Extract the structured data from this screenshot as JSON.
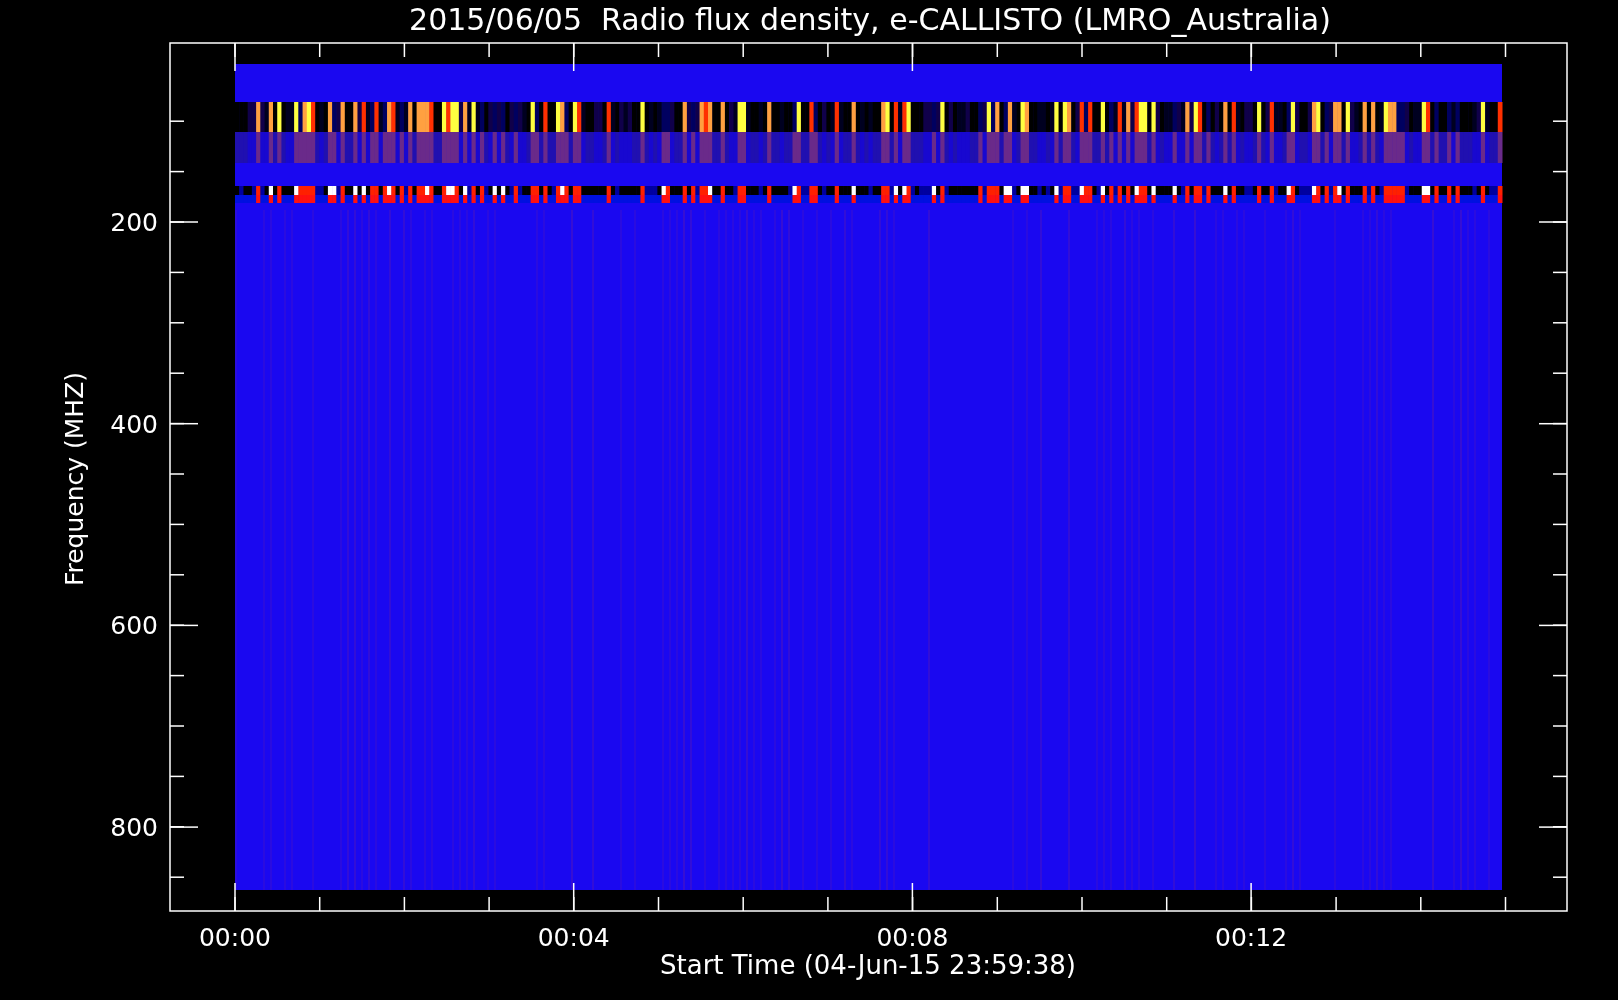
{
  "title": "2015/06/05  Radio flux density, e-CALLISTO (LMRO_Australia)",
  "y_axis": {
    "label": "Frequency (MHZ)",
    "ticks": [
      "200",
      "400",
      "600",
      "800"
    ]
  },
  "x_axis": {
    "label": "Start Time (04-Jun-15 23:59:38)",
    "ticks": [
      "00:00",
      "00:04",
      "00:08",
      "00:12"
    ]
  }
}
